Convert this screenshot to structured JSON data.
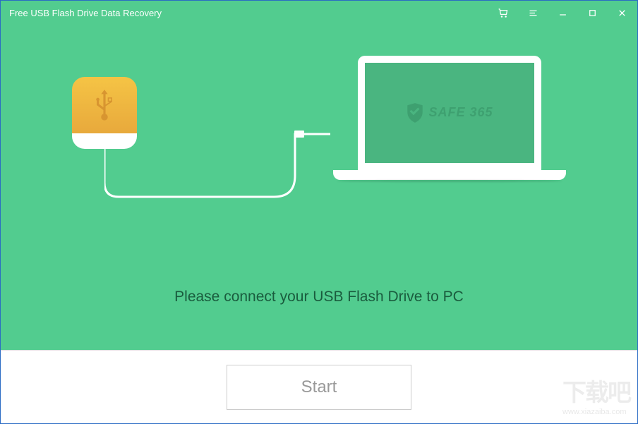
{
  "window": {
    "title": "Free USB Flash Drive Data Recovery"
  },
  "brand": {
    "name": "SAFE 365"
  },
  "instruction": {
    "text": "Please connect your USB Flash Drive to PC"
  },
  "actions": {
    "start_label": "Start"
  },
  "icons": {
    "cart": "cart-icon",
    "menu": "menu-icon",
    "minimize": "minimize-icon",
    "maximize": "maximize-icon",
    "close": "close-icon",
    "usb": "usb-icon",
    "shield": "shield-icon"
  },
  "watermark": {
    "chars": "下载吧",
    "url": "www.xiazaiba.com"
  }
}
